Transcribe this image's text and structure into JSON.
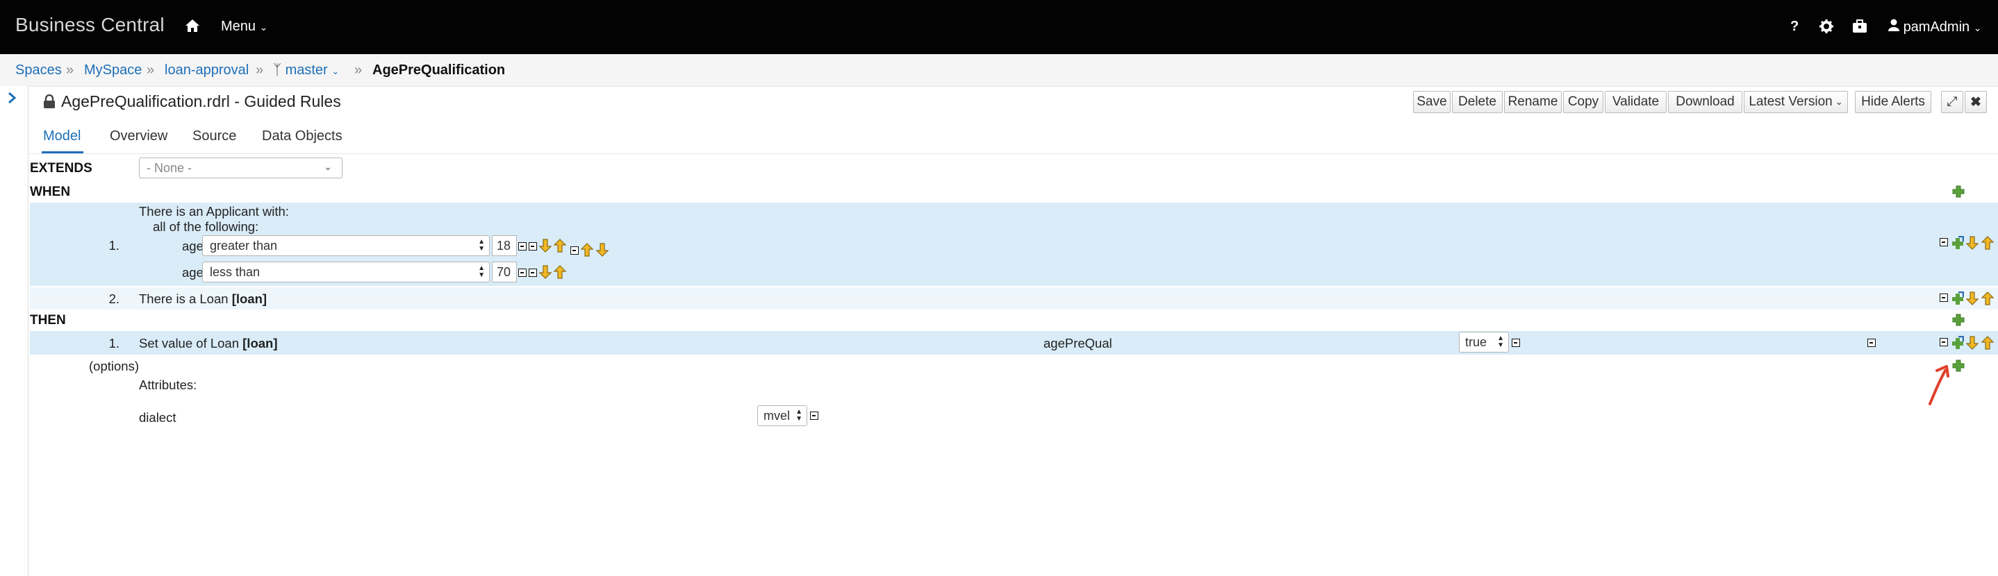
{
  "app": {
    "brand": "Business Central",
    "menu_label": "Menu",
    "user_label": "pamAdmin"
  },
  "breadcrumb": {
    "items": [
      "Spaces",
      "MySpace",
      "loan-approval",
      "master",
      "AgePreQualification"
    ]
  },
  "editor": {
    "title": "AgePreQualification.rdrl - Guided Rules",
    "toolbar": [
      "Save",
      "Delete",
      "Rename",
      "Copy",
      "Validate",
      "Download",
      "Latest Version",
      "Hide Alerts"
    ],
    "tabs": [
      "Model",
      "Overview",
      "Source",
      "Data Objects"
    ]
  },
  "rule": {
    "extends_label": "EXTENDS",
    "extends_value": "- None -",
    "when_label": "WHEN",
    "then_label": "THEN",
    "when_rows": [
      {
        "num": "1.",
        "line1": "There is an Applicant with:",
        "line2": "all of the following:",
        "constraints": [
          {
            "field": "age",
            "operator": "greater than",
            "value": "18"
          },
          {
            "field": "age",
            "operator": "less than",
            "value": "70"
          }
        ]
      },
      {
        "num": "2.",
        "text": "There is a Loan",
        "binding": "[loan]"
      }
    ],
    "then_rows": [
      {
        "num": "1.",
        "text": "Set value of Loan",
        "binding": "[loan]",
        "field": "agePreQual",
        "value": "true"
      }
    ],
    "options_label": "(options)",
    "attributes_label": "Attributes:",
    "attribute": {
      "name": "dialect",
      "value": "mvel"
    }
  },
  "colors": {
    "accent": "#1d6fb8",
    "band": "#d9ecf8",
    "navbar": "#030303",
    "plus_green": "#5aa13b",
    "annotation_red": "#e0402b"
  }
}
